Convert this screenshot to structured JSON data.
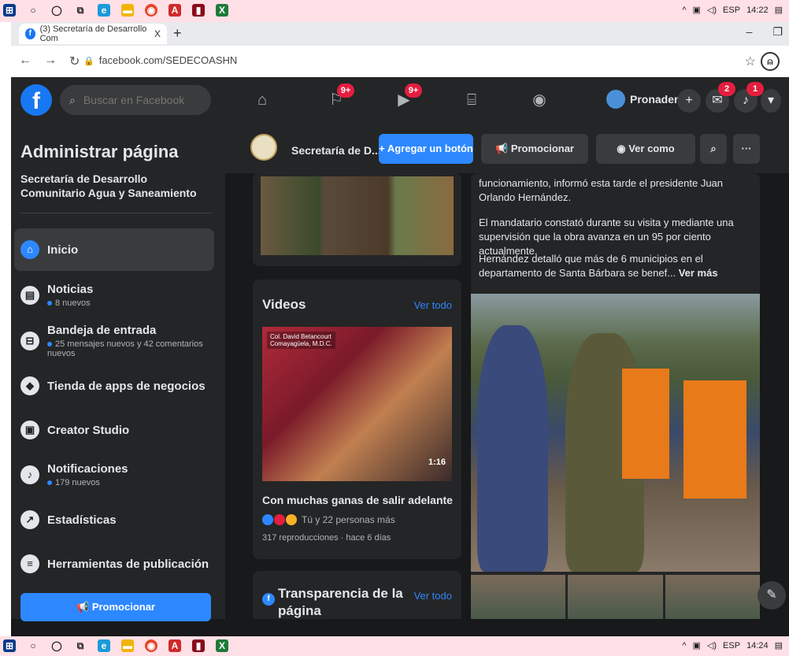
{
  "os": {
    "time_top": "14:22",
    "time_bottom": "14:24",
    "lang": "ESP",
    "tray_icons": [
      "chevron-up-icon",
      "network-icon",
      "volume-icon"
    ]
  },
  "browser": {
    "tab_title": "(3) Secretaría de Desarrollo Com",
    "tab_close": "X",
    "new_tab": "+",
    "url": "facebook.com/SEDECOASHN",
    "min": "–",
    "restore": "❐"
  },
  "fb_header": {
    "search_placeholder": "Buscar en Facebook",
    "badges": {
      "flag": "9+",
      "video": "9+",
      "messenger": "2",
      "notifications": "1"
    },
    "profile_name": "Pronaders"
  },
  "sidebar": {
    "title": "Administrar página",
    "page_name": "Secretaría de Desarrollo Comunitario Agua y Saneamiento",
    "items": [
      {
        "label": "Inicio",
        "sub": ""
      },
      {
        "label": "Noticias",
        "sub": "8 nuevos"
      },
      {
        "label": "Bandeja de entrada",
        "sub": "25 mensajes nuevos y 42 comentarios nuevos"
      },
      {
        "label": "Tienda de apps de negocios",
        "sub": ""
      },
      {
        "label": "Creator Studio",
        "sub": ""
      },
      {
        "label": "Notificaciones",
        "sub": "179 nuevos"
      },
      {
        "label": "Estadísticas",
        "sub": ""
      },
      {
        "label": "Herramientas de publicación",
        "sub": ""
      }
    ],
    "promote_label": "Promocionar"
  },
  "page_bar": {
    "page_short_name": "Secretaría de D...",
    "add_button": "+ Agregar un botón",
    "promote": "Promocionar",
    "view_as": "Ver como visitante",
    "more": "···"
  },
  "videos": {
    "title": "Videos",
    "see_all": "Ver todo",
    "thumb_tag_line1": "Col. David Betancourt",
    "thumb_tag_line2": "Comayagüela, M.D.C.",
    "duration": "1:16",
    "video_title": "Con muchas ganas de salir adelante y ha...",
    "reactions_text": "Tú y 22 personas más",
    "meta": "317 reproducciones · hace 6 días"
  },
  "transparency": {
    "title": "Transparencia de la página",
    "see_all": "Ver todo"
  },
  "post": {
    "p1": "funcionamiento, informó esta tarde el presidente Juan Orlando Hernández.",
    "p2": "El mandatario constató durante su visita y mediante una supervisión que la obra avanza en un 95 por ciento actualmente.",
    "p3": "Hernández detalló que más de 6 municipios en el departamento de Santa Bárbara se benef...",
    "see_more": "Ver más"
  },
  "colors": {
    "fb_blue": "#1877f2",
    "accent": "#2d88ff",
    "badge_red": "#e41e3f",
    "bg": "#18191a",
    "surface": "#242526"
  }
}
